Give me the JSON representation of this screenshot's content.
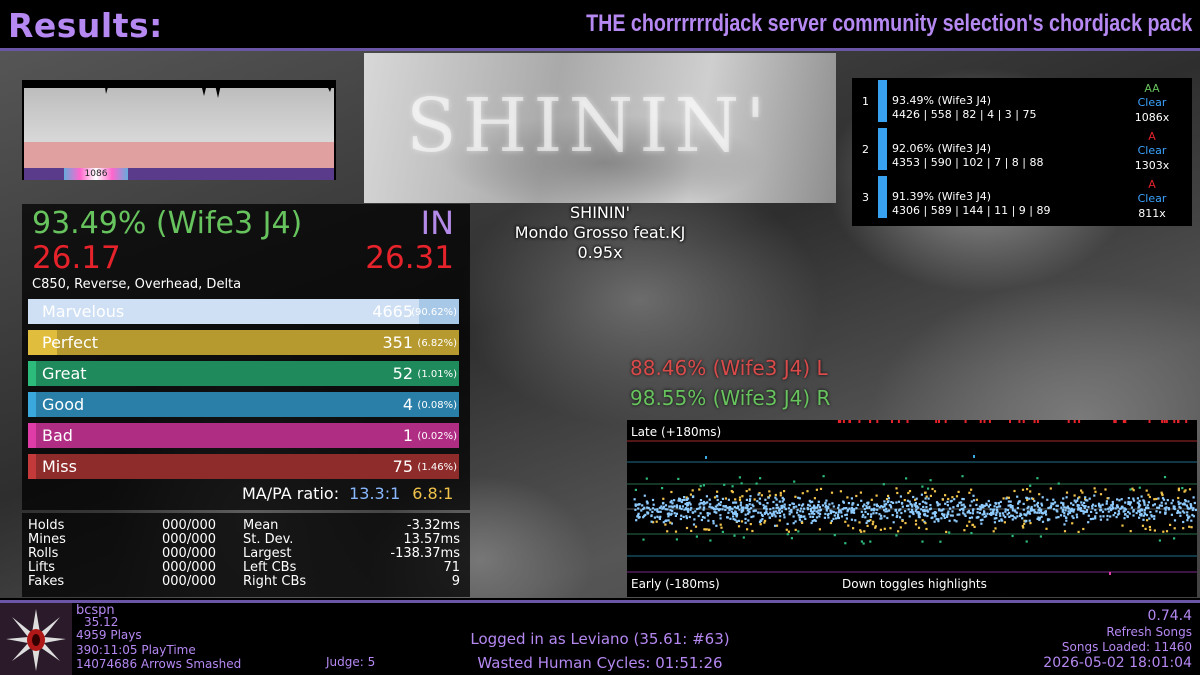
{
  "header": {
    "title": "Results:",
    "pack": "THE chorrrrrrdjack server community selection's chordjack pack"
  },
  "lifegraph": {
    "marker_label": "1086"
  },
  "banner": {
    "text": "SHININ'"
  },
  "song": {
    "title": "SHININ'",
    "artist": "Mondo Grosso feat.KJ",
    "rate": "0.95x"
  },
  "score": {
    "wife": "93.49% (Wife3 J4)",
    "grade": "IN",
    "msd": "26.17",
    "ssr": "26.31",
    "mods": "C850, Reverse, Overhead, Delta",
    "judgments": [
      {
        "name": "Marvelous",
        "count": "4665",
        "pct": "(90.62%)",
        "fraction": 0.9062,
        "color": "#a8c8e8",
        "cap": "#cfe0f4"
      },
      {
        "name": "Perfect",
        "count": "351",
        "pct": "(6.82%)",
        "fraction": 0.0682,
        "color": "#b69a2f",
        "cap": "#e0bd3c"
      },
      {
        "name": "Great",
        "count": "52",
        "pct": "(1.01%)",
        "fraction": 0.0101,
        "color": "#1f8a5c",
        "cap": "#2dbb7c"
      },
      {
        "name": "Good",
        "count": "4",
        "pct": "(0.08%)",
        "fraction": 0.0008,
        "color": "#2a7fa8",
        "cap": "#3aa8dc"
      },
      {
        "name": "Bad",
        "count": "1",
        "pct": "(0.02%)",
        "fraction": 0.0002,
        "color": "#b02d84",
        "cap": "#e03ca8"
      },
      {
        "name": "Miss",
        "count": "75",
        "pct": "(1.46%)",
        "fraction": 0.0146,
        "color": "#8e2b2b",
        "cap": "#c43a3a"
      }
    ],
    "mapa_label": "MA/PA ratio:",
    "ma_ratio": "13.3:1",
    "pa_ratio": "6.8:1"
  },
  "stats": {
    "left": [
      {
        "label": "Holds",
        "value": "000/000"
      },
      {
        "label": "Mines",
        "value": "000/000"
      },
      {
        "label": "Rolls",
        "value": "000/000"
      },
      {
        "label": "Lifts",
        "value": "000/000"
      },
      {
        "label": "Fakes",
        "value": "000/000"
      }
    ],
    "right": [
      {
        "label": "Mean",
        "value": "-3.32ms"
      },
      {
        "label": "St. Dev.",
        "value": "13.57ms"
      },
      {
        "label": "Largest",
        "value": "-138.37ms"
      },
      {
        "label": "Left CBs",
        "value": "71"
      },
      {
        "label": "Right CBs",
        "value": "9"
      }
    ]
  },
  "scoreboard": [
    {
      "rank": "1",
      "pct": "93.49% (Wife3 J4)",
      "detail": "4426 | 558 | 82 | 4 | 3 | 75",
      "grade": "AA",
      "grade_color": "#67c35d",
      "clear": "Clear",
      "combo": "1086x"
    },
    {
      "rank": "2",
      "pct": "92.06% (Wife3 J4)",
      "detail": "4353 | 590 | 102 | 7 | 8 | 88",
      "grade": "A",
      "grade_color": "#e6222b",
      "clear": "Clear",
      "combo": "1303x"
    },
    {
      "rank": "3",
      "pct": "91.39% (Wife3 J4)",
      "detail": "4306 | 589 | 144 | 11 | 9 | 89",
      "grade": "A",
      "grade_color": "#e6222b",
      "clear": "Clear",
      "combo": "811x"
    }
  ],
  "hands": {
    "left": "88.46% (Wife3 J4) L",
    "left_color": "#d94a4a",
    "right": "98.55% (Wife3 J4) R",
    "right_color": "#67c35d"
  },
  "offset_plot": {
    "late_label": "Late (+180ms)",
    "early_label": "Early (-180ms)",
    "hint": "Down toggles highlights"
  },
  "player": {
    "name": "bcspn",
    "rating": "35.12",
    "plays": "4959 Plays",
    "playtime": "390:11:05 PlayTime",
    "arrows": "14074686 Arrows Smashed"
  },
  "footer": {
    "judge": "Judge: 5",
    "login": "Logged in as Leviano (35.61: #63)",
    "wasted": "Wasted Human Cycles: 01:51:26",
    "version": "0.74.4",
    "refresh": "Refresh Songs",
    "songs_loaded": "Songs Loaded: 11460",
    "datetime": "2026-05-02 18:01:04"
  },
  "colors": {
    "accent": "#b588f2",
    "late_line": "#e6222b",
    "marvelous_dots": "#8ecbff",
    "perfect_dots": "#f2c34a",
    "great_dots": "#2dbb7c"
  }
}
